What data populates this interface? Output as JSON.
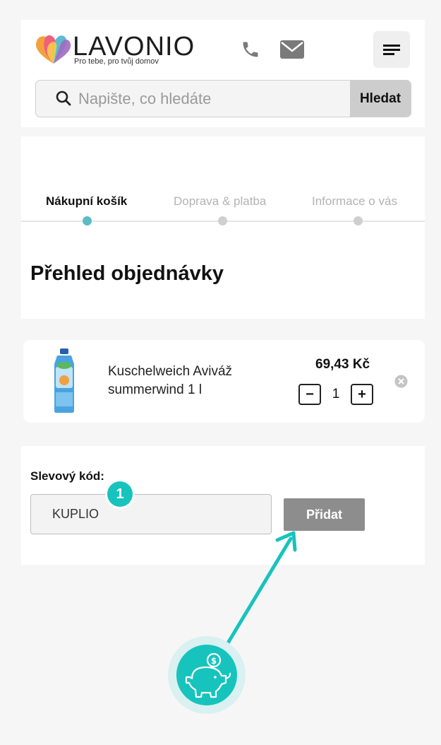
{
  "header": {
    "brand": "LAVONIO",
    "tagline": "Pro tebe, pro tvůj domov",
    "search_placeholder": "Napište, co hledáte",
    "search_button": "Hledat"
  },
  "steps": [
    {
      "label": "Nákupní košík",
      "active": true
    },
    {
      "label": "Doprava & platba",
      "active": false
    },
    {
      "label": "Informace o vás",
      "active": false
    }
  ],
  "page_title": "Přehled objednávky",
  "cart_item": {
    "name": "Kuschelweich Aviváž summerwind 1 l",
    "price": "69,43 Kč",
    "quantity": "1",
    "minus": "−",
    "plus": "+"
  },
  "coupon": {
    "label": "Slevový kód:",
    "value": "KUPLIO",
    "button": "Přidat",
    "step_badge": "1"
  },
  "colors": {
    "accent": "#17c3bd",
    "active_step_dot": "#5bbcc7",
    "inactive_step_dot": "#cfcfcf",
    "button_gray": "#8d8d8d"
  },
  "icons": {
    "logo": "heart-leaves-logo",
    "phone": "phone-icon",
    "mail": "mail-icon",
    "menu": "menu-icon",
    "search": "search-icon",
    "remove": "close-circle-icon",
    "piggy": "piggy-bank-icon"
  }
}
